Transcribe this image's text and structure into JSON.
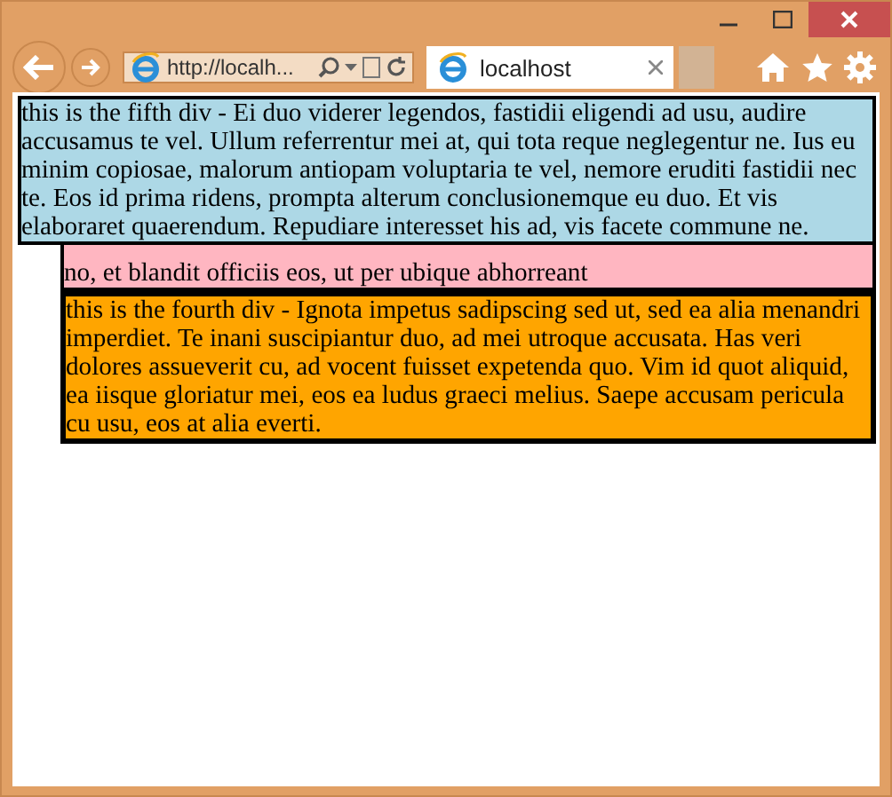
{
  "address_bar": {
    "value": "http://localh..."
  },
  "tabs": [
    {
      "label": "localhost",
      "selected": true
    }
  ],
  "page": {
    "divs": [
      {
        "kind": "overlay",
        "color": "#add8e6",
        "text": "this is the fifth div - Ei duo viderer legendos, fastidii eligendi ad usu, audire accusamus te vel. Ullum referrentur mei at, qui tota reque neglegentur ne. Ius eu minim copiosae, malorum antiopam voluptaria te vel, nemore eruditi fastidii nec te. Eos id prima ridens, prompta alterum conclusionemque eu duo. Et vis elaboraret quaerendum. Repudiare interesset his ad, vis facete commune ne."
      },
      {
        "kind": "flow",
        "color": "#ffb6c1",
        "text": "no, et blandit officiis eos, ut per ubique abhorreant"
      },
      {
        "kind": "flow",
        "color": "#ffa500",
        "text": "this is the fourth div - Ignota impetus sadipscing sed ut, sed ea alia menandri imperdiet. Te inani suscipiantur duo, ad mei utroque accusata. Has veri dolores assueverit cu, ad vocent fuisset expetenda quo. Vim id quot aliquid, ea iisque gloriatur mei, eos ea ludus graeci melius. Saepe accusam pericula cu usu, eos at alia everti."
      }
    ]
  }
}
